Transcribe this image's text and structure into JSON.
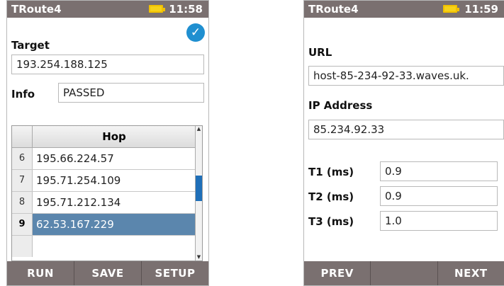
{
  "left_screen": {
    "title": "TRoute4",
    "time": "11:58",
    "target_label": "Target",
    "target_value": "193.254.188.125",
    "info_label": "Info",
    "info_value": "PASSED",
    "table": {
      "header": "Hop",
      "rows": [
        {
          "num": "6",
          "ip": "195.66.224.57"
        },
        {
          "num": "7",
          "ip": "195.71.254.109"
        },
        {
          "num": "8",
          "ip": "195.71.212.134"
        },
        {
          "num": "9",
          "ip": "62.53.167.229"
        }
      ]
    },
    "buttons": [
      "RUN",
      "SAVE",
      "SETUP"
    ]
  },
  "right_screen": {
    "title": "TRoute4",
    "time": "11:59",
    "url_label": "URL",
    "url_value": "host-85-234-92-33.waves.uk.",
    "ip_label": "IP Address",
    "ip_value": "85.234.92.33",
    "t1_label": "T1 (ms)",
    "t1_value": "0.9",
    "t2_label": "T2 (ms)",
    "t2_value": "0.9",
    "t3_label": "T3 (ms)",
    "t3_value": "1.0",
    "buttons": [
      "PREV",
      "",
      "NEXT"
    ]
  },
  "colors": {
    "titlebar": "#7a7070",
    "selected_row": "#5b86ad",
    "battery": "#f6d21a",
    "check": "#1f8fd0"
  }
}
